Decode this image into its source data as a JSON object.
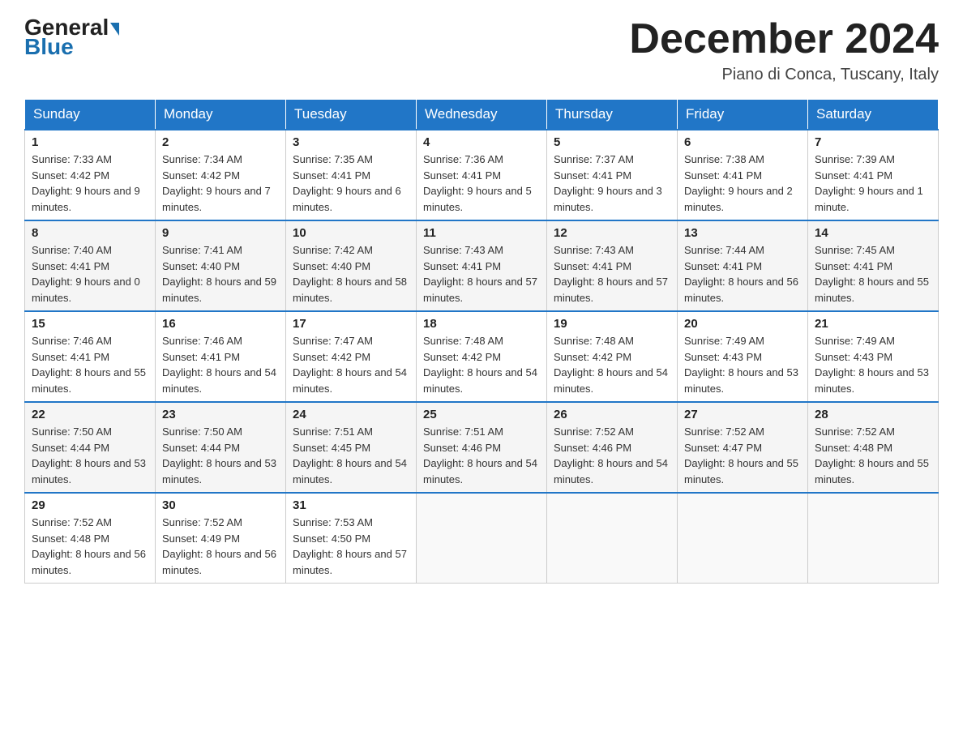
{
  "header": {
    "logo_general": "General",
    "logo_blue": "Blue",
    "month_title": "December 2024",
    "location": "Piano di Conca, Tuscany, Italy"
  },
  "days_of_week": [
    "Sunday",
    "Monday",
    "Tuesday",
    "Wednesday",
    "Thursday",
    "Friday",
    "Saturday"
  ],
  "weeks": [
    [
      {
        "day": "1",
        "sunrise": "7:33 AM",
        "sunset": "4:42 PM",
        "daylight": "9 hours and 9 minutes."
      },
      {
        "day": "2",
        "sunrise": "7:34 AM",
        "sunset": "4:42 PM",
        "daylight": "9 hours and 7 minutes."
      },
      {
        "day": "3",
        "sunrise": "7:35 AM",
        "sunset": "4:41 PM",
        "daylight": "9 hours and 6 minutes."
      },
      {
        "day": "4",
        "sunrise": "7:36 AM",
        "sunset": "4:41 PM",
        "daylight": "9 hours and 5 minutes."
      },
      {
        "day": "5",
        "sunrise": "7:37 AM",
        "sunset": "4:41 PM",
        "daylight": "9 hours and 3 minutes."
      },
      {
        "day": "6",
        "sunrise": "7:38 AM",
        "sunset": "4:41 PM",
        "daylight": "9 hours and 2 minutes."
      },
      {
        "day": "7",
        "sunrise": "7:39 AM",
        "sunset": "4:41 PM",
        "daylight": "9 hours and 1 minute."
      }
    ],
    [
      {
        "day": "8",
        "sunrise": "7:40 AM",
        "sunset": "4:41 PM",
        "daylight": "9 hours and 0 minutes."
      },
      {
        "day": "9",
        "sunrise": "7:41 AM",
        "sunset": "4:40 PM",
        "daylight": "8 hours and 59 minutes."
      },
      {
        "day": "10",
        "sunrise": "7:42 AM",
        "sunset": "4:40 PM",
        "daylight": "8 hours and 58 minutes."
      },
      {
        "day": "11",
        "sunrise": "7:43 AM",
        "sunset": "4:41 PM",
        "daylight": "8 hours and 57 minutes."
      },
      {
        "day": "12",
        "sunrise": "7:43 AM",
        "sunset": "4:41 PM",
        "daylight": "8 hours and 57 minutes."
      },
      {
        "day": "13",
        "sunrise": "7:44 AM",
        "sunset": "4:41 PM",
        "daylight": "8 hours and 56 minutes."
      },
      {
        "day": "14",
        "sunrise": "7:45 AM",
        "sunset": "4:41 PM",
        "daylight": "8 hours and 55 minutes."
      }
    ],
    [
      {
        "day": "15",
        "sunrise": "7:46 AM",
        "sunset": "4:41 PM",
        "daylight": "8 hours and 55 minutes."
      },
      {
        "day": "16",
        "sunrise": "7:46 AM",
        "sunset": "4:41 PM",
        "daylight": "8 hours and 54 minutes."
      },
      {
        "day": "17",
        "sunrise": "7:47 AM",
        "sunset": "4:42 PM",
        "daylight": "8 hours and 54 minutes."
      },
      {
        "day": "18",
        "sunrise": "7:48 AM",
        "sunset": "4:42 PM",
        "daylight": "8 hours and 54 minutes."
      },
      {
        "day": "19",
        "sunrise": "7:48 AM",
        "sunset": "4:42 PM",
        "daylight": "8 hours and 54 minutes."
      },
      {
        "day": "20",
        "sunrise": "7:49 AM",
        "sunset": "4:43 PM",
        "daylight": "8 hours and 53 minutes."
      },
      {
        "day": "21",
        "sunrise": "7:49 AM",
        "sunset": "4:43 PM",
        "daylight": "8 hours and 53 minutes."
      }
    ],
    [
      {
        "day": "22",
        "sunrise": "7:50 AM",
        "sunset": "4:44 PM",
        "daylight": "8 hours and 53 minutes."
      },
      {
        "day": "23",
        "sunrise": "7:50 AM",
        "sunset": "4:44 PM",
        "daylight": "8 hours and 53 minutes."
      },
      {
        "day": "24",
        "sunrise": "7:51 AM",
        "sunset": "4:45 PM",
        "daylight": "8 hours and 54 minutes."
      },
      {
        "day": "25",
        "sunrise": "7:51 AM",
        "sunset": "4:46 PM",
        "daylight": "8 hours and 54 minutes."
      },
      {
        "day": "26",
        "sunrise": "7:52 AM",
        "sunset": "4:46 PM",
        "daylight": "8 hours and 54 minutes."
      },
      {
        "day": "27",
        "sunrise": "7:52 AM",
        "sunset": "4:47 PM",
        "daylight": "8 hours and 55 minutes."
      },
      {
        "day": "28",
        "sunrise": "7:52 AM",
        "sunset": "4:48 PM",
        "daylight": "8 hours and 55 minutes."
      }
    ],
    [
      {
        "day": "29",
        "sunrise": "7:52 AM",
        "sunset": "4:48 PM",
        "daylight": "8 hours and 56 minutes."
      },
      {
        "day": "30",
        "sunrise": "7:52 AM",
        "sunset": "4:49 PM",
        "daylight": "8 hours and 56 minutes."
      },
      {
        "day": "31",
        "sunrise": "7:53 AM",
        "sunset": "4:50 PM",
        "daylight": "8 hours and 57 minutes."
      },
      null,
      null,
      null,
      null
    ]
  ]
}
